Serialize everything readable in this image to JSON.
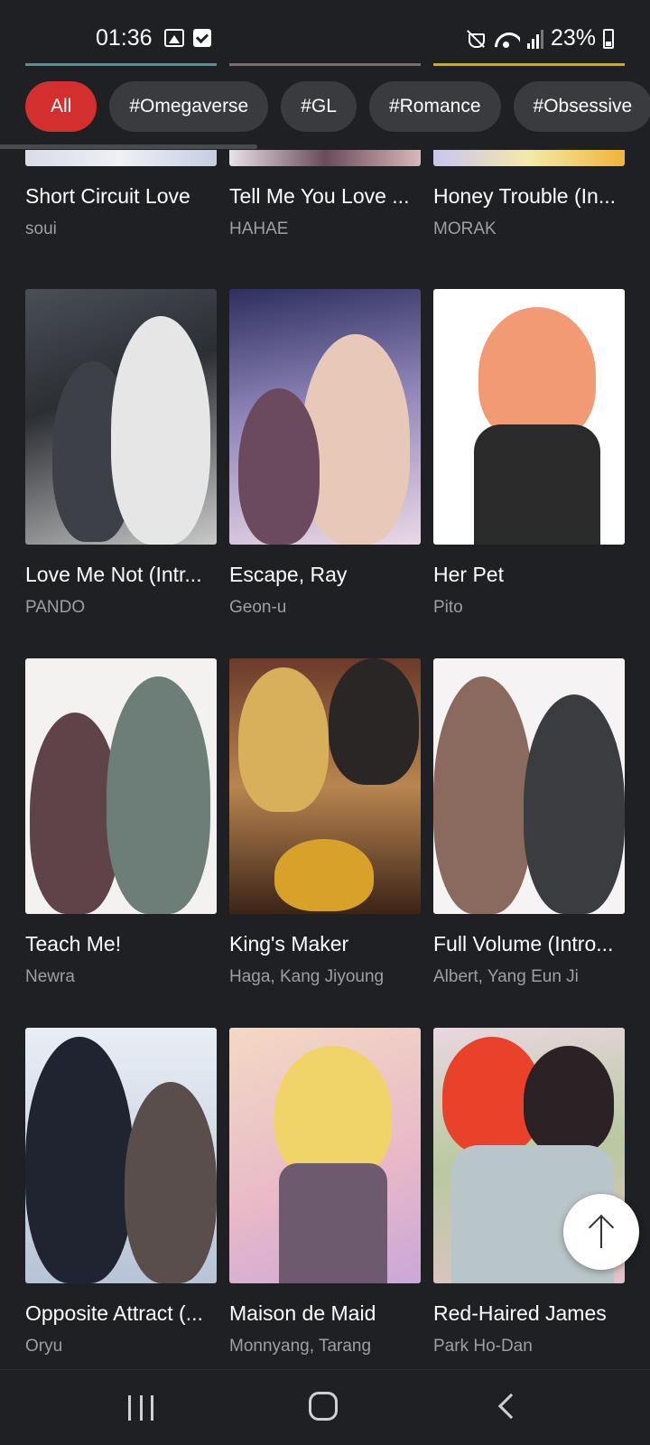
{
  "status_bar": {
    "time": "01:36",
    "battery": "23%",
    "icons": [
      "gallery-icon",
      "checkbox-icon",
      "mute-icon",
      "wifi-icon",
      "signal-icon",
      "battery-icon"
    ]
  },
  "filters": {
    "chips": [
      "All",
      "#Omegaverse",
      "#GL",
      "#Romance",
      "#Obsessive"
    ],
    "active": "All",
    "active_color": "#d32f2f"
  },
  "top_row": [
    {
      "title": "Short Circuit Love",
      "author": "soui"
    },
    {
      "title": "Tell Me You Love ...",
      "author": "HAHAE"
    },
    {
      "title": "Honey Trouble (In...",
      "author": "MORAK"
    }
  ],
  "rows": [
    [
      {
        "title": "Love Me Not (Intr...",
        "author": "PANDO"
      },
      {
        "title": "Escape, Ray",
        "author": "Geon-u"
      },
      {
        "title": "Her Pet",
        "author": "Pito"
      }
    ],
    [
      {
        "title": "Teach Me!",
        "author": "Newra"
      },
      {
        "title": "King's Maker",
        "author": "Haga, Kang Jiyoung"
      },
      {
        "title": "Full Volume (Intro...",
        "author": "Albert, Yang Eun Ji"
      }
    ],
    [
      {
        "title": "Opposite Attract (...",
        "author": "Oryu"
      },
      {
        "title": "Maison de Maid",
        "author": "Monnyang, Tarang"
      },
      {
        "title": "Red-Haired James",
        "author": "Park Ho-Dan"
      }
    ]
  ],
  "scroll_top_icon": "arrow-up-icon",
  "nav_icons": [
    "recents-icon",
    "home-icon",
    "back-icon"
  ]
}
